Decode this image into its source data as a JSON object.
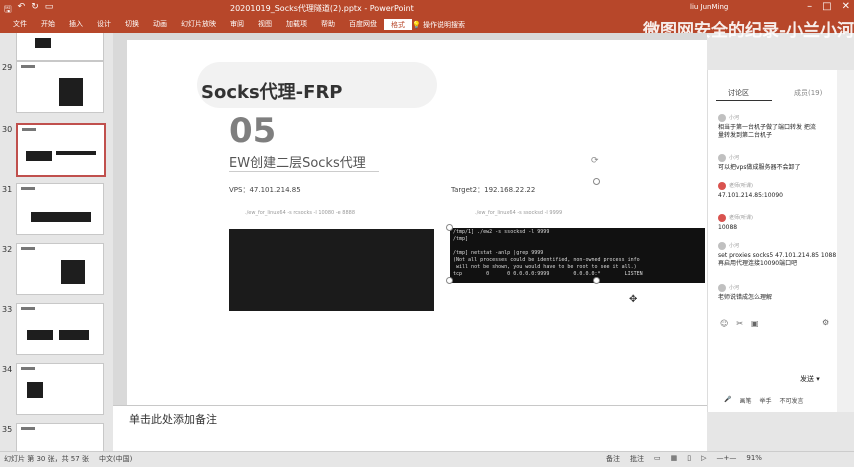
{
  "window": {
    "title": "20201019_Socks代理隧道(2).pptx - PowerPoint",
    "user": "liu JunMing"
  },
  "ribbon": {
    "tabs": [
      "文件",
      "开始",
      "插入",
      "设计",
      "切换",
      "动画",
      "幻灯片放映",
      "审阅",
      "视图",
      "加载项",
      "帮助",
      "百度网盘",
      "格式"
    ],
    "active_tab": "格式",
    "tell_me": "操作说明搜索"
  },
  "watermark": "微图网安全的纪录-小兰小河",
  "thumbnails": {
    "numbers": [
      "29",
      "30",
      "31",
      "32",
      "33",
      "34",
      "35"
    ]
  },
  "slide": {
    "title": "Socks代理-FRP",
    "number": "05",
    "subtitle": "EW创建二层Socks代理",
    "vps_label": "VPS：47.101.214.85",
    "target_label": "Target2：192.168.22.22",
    "faint_left": "./ew_for_linux64 -s rcsocks -l 10080 -e 8888",
    "faint_right": "./ew_for_linux64 -s ssocksd -l 9999",
    "terminal_lines": [
      "/tmp/1] ./ew2 -s ssocksd -l 9999",
      "/tmp]",
      "",
      "/tmp] netstat -anlp |grep 9999",
      "(Not all processes could be identified, non-owned process info",
      " will not be shown, you would have to be root to see it all.)",
      "tcp        0      0 0.0.0.0:9999        0.0.0.0:*        LISTEN"
    ]
  },
  "notes": {
    "placeholder": "单击此处添加备注"
  },
  "chat": {
    "tabs": [
      "讨论区",
      "成员(19)"
    ],
    "messages": [
      {
        "name": "小河",
        "text": "相当于第一台机子做了端口转发 把流\n量转发到第二台机子"
      },
      {
        "name": "小河",
        "text": "可以把vps做成服务器不会卸了"
      },
      {
        "name": "老师(听课)",
        "text": "47.101.214.85:10090"
      },
      {
        "name": "老师(听课)",
        "text": "10088"
      },
      {
        "name": "小河",
        "text": "set proxies socks5 47.101.214.85 1088\n再启用代理连接10090端口吧"
      },
      {
        "name": "小河",
        "text": "老师说错成怎么理解"
      }
    ],
    "send_label": "发送",
    "bottom_links": [
      "画笔",
      "举手",
      "不可发言"
    ]
  },
  "status": {
    "slide_info": "幻灯片 第 30 张，共 57 张",
    "language": "中文(中国)",
    "notes": "备注",
    "comments": "批注",
    "zoom": "91%"
  }
}
